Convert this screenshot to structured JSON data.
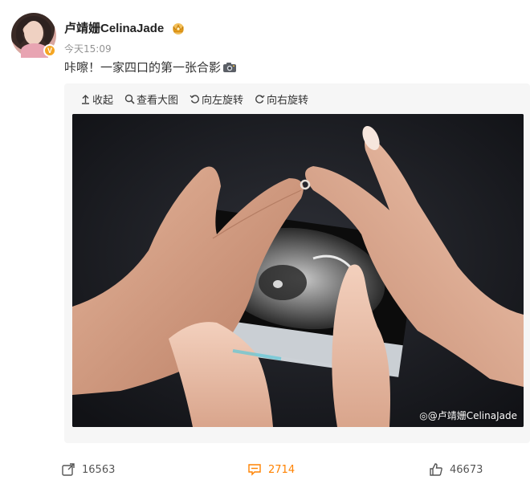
{
  "post": {
    "username": "卢靖姗CelinaJade",
    "verified_badge": "V",
    "timestamp": "今天15:09",
    "text": "咔嚓！一家四口的第一张合影"
  },
  "toolbar": {
    "collapse": "收起",
    "view_large": "查看大图",
    "rotate_left": "向左旋转",
    "rotate_right": "向右旋转"
  },
  "image": {
    "watermark": "@卢靖姗CelinaJade"
  },
  "stats": {
    "reposts": "16563",
    "comments": "2714",
    "likes": "46673"
  },
  "icons": {
    "crown": "crown-badge-icon",
    "camera": "camera-icon",
    "collapse": "arrow-up-icon",
    "view_large": "magnifier-icon",
    "rotate_left": "rotate-left-icon",
    "rotate_right": "rotate-right-icon",
    "repost": "repost-icon",
    "comment": "comment-icon",
    "like": "thumb-up-icon"
  },
  "colors": {
    "comment_accent": "#ff8200",
    "badge": "#f5a623",
    "card_bg": "#f6f6f6"
  }
}
